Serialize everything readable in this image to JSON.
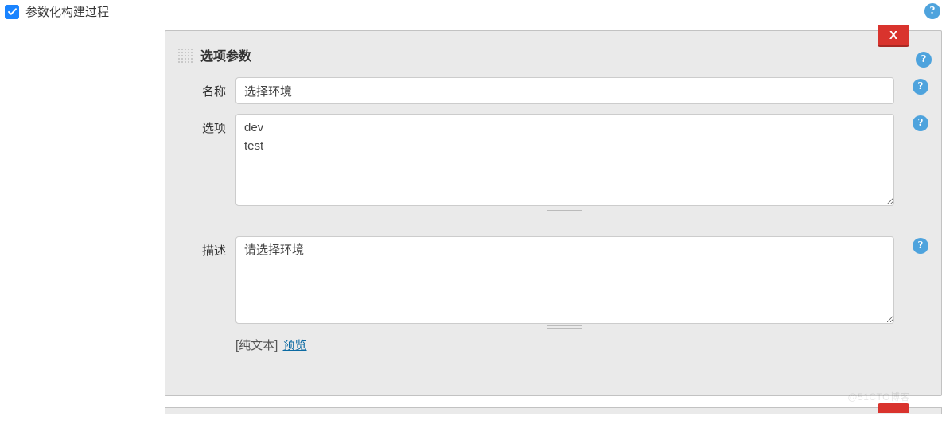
{
  "header": {
    "checkbox_label": "参数化构建过程",
    "checked": true
  },
  "parameter_block": {
    "title": "选项参数",
    "delete_label": "X",
    "fields": {
      "name": {
        "label": "名称",
        "value": "选择环境"
      },
      "choices": {
        "label": "选项",
        "value": "dev\ntest"
      },
      "description": {
        "label": "描述",
        "value": "请选择环境"
      }
    },
    "footer": {
      "format_label": "[纯文本]",
      "preview_label": "预览"
    }
  },
  "help_symbol": "?",
  "watermark": "@51CTO博客"
}
